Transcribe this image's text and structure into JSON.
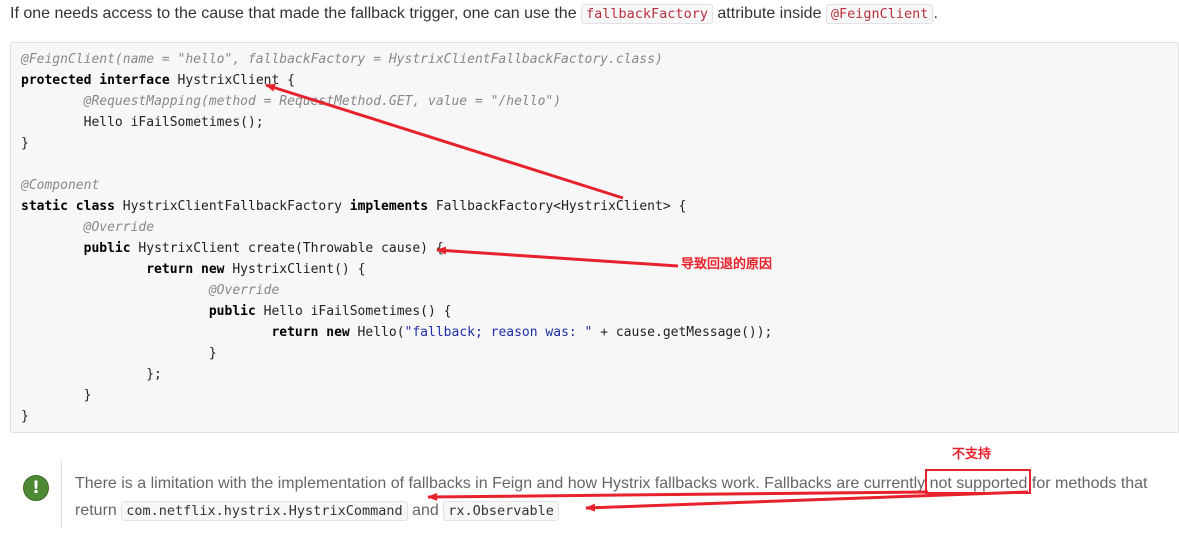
{
  "intro": {
    "before": "If one needs access to the cause that made the fallback trigger, one can use the ",
    "code1": "fallbackFactory",
    "middle": " attribute inside ",
    "code2": "@FeignClient",
    "after": "."
  },
  "code_lines": [
    {
      "indent": "",
      "parts": [
        {
          "t": "@FeignClient(name = \"hello\", fallbackFactory = HystrixClientFallbackFactory.class)",
          "c": "ann"
        }
      ]
    },
    {
      "indent": "",
      "parts": [
        {
          "t": "protected",
          "c": "kw"
        },
        {
          "t": " ",
          "c": ""
        },
        {
          "t": "interface",
          "c": "kw"
        },
        {
          "t": " HystrixClient {",
          "c": ""
        }
      ]
    },
    {
      "indent": "        ",
      "parts": [
        {
          "t": "@RequestMapping(method = RequestMethod.GET, value = \"/hello\")",
          "c": "ann"
        }
      ]
    },
    {
      "indent": "        ",
      "parts": [
        {
          "t": "Hello iFailSometimes();",
          "c": ""
        }
      ]
    },
    {
      "indent": "",
      "parts": [
        {
          "t": "}",
          "c": ""
        }
      ]
    },
    {
      "indent": "",
      "parts": []
    },
    {
      "indent": "",
      "parts": [
        {
          "t": "@Component",
          "c": "ann"
        }
      ]
    },
    {
      "indent": "",
      "parts": [
        {
          "t": "static",
          "c": "kw"
        },
        {
          "t": " ",
          "c": ""
        },
        {
          "t": "class",
          "c": "kw"
        },
        {
          "t": " HystrixClientFallbackFactory ",
          "c": ""
        },
        {
          "t": "implements",
          "c": "kw"
        },
        {
          "t": " FallbackFactory<HystrixClient> {",
          "c": ""
        }
      ]
    },
    {
      "indent": "        ",
      "parts": [
        {
          "t": "@Override",
          "c": "ann"
        }
      ]
    },
    {
      "indent": "        ",
      "parts": [
        {
          "t": "public",
          "c": "kw"
        },
        {
          "t": " HystrixClient create(Throwable cause) {",
          "c": ""
        }
      ]
    },
    {
      "indent": "                ",
      "parts": [
        {
          "t": "return",
          "c": "kw"
        },
        {
          "t": " ",
          "c": ""
        },
        {
          "t": "new",
          "c": "kw"
        },
        {
          "t": " HystrixClient() {",
          "c": ""
        }
      ]
    },
    {
      "indent": "                        ",
      "parts": [
        {
          "t": "@Override",
          "c": "ann"
        }
      ]
    },
    {
      "indent": "                        ",
      "parts": [
        {
          "t": "public",
          "c": "kw"
        },
        {
          "t": " Hello iFailSometimes() {",
          "c": ""
        }
      ]
    },
    {
      "indent": "                                ",
      "parts": [
        {
          "t": "return",
          "c": "kw"
        },
        {
          "t": " ",
          "c": ""
        },
        {
          "t": "new",
          "c": "kw"
        },
        {
          "t": " Hello(",
          "c": ""
        },
        {
          "t": "\"fallback; reason was: \"",
          "c": "str"
        },
        {
          "t": " + cause.getMessage());",
          "c": ""
        }
      ]
    },
    {
      "indent": "                        ",
      "parts": [
        {
          "t": "}",
          "c": ""
        }
      ]
    },
    {
      "indent": "                ",
      "parts": [
        {
          "t": "};",
          "c": ""
        }
      ]
    },
    {
      "indent": "        ",
      "parts": [
        {
          "t": "}",
          "c": ""
        }
      ]
    },
    {
      "indent": "",
      "parts": [
        {
          "t": "}",
          "c": ""
        }
      ]
    }
  ],
  "admonition": {
    "icon": "!",
    "line1_before": "There is a limitation with the implementation of fallbacks in Feign and how Hystrix fallbacks work. Fallbacks are currently ",
    "highlight": "not supported",
    "line1_after": " for methods that",
    "line2_before": "return ",
    "code1": "com.netflix.hystrix.HystrixCommand",
    "and": " and ",
    "code2": "rx.Observable"
  },
  "annotations": {
    "cause_label": "导致回退的原因",
    "unsupported_label": "不支持"
  },
  "colors": {
    "annotation_red": "#e8222c",
    "tip_green": "#4e8a33",
    "code_bg": "#f7f7f7"
  },
  "icons": {
    "tip": "exclamation-icon"
  }
}
